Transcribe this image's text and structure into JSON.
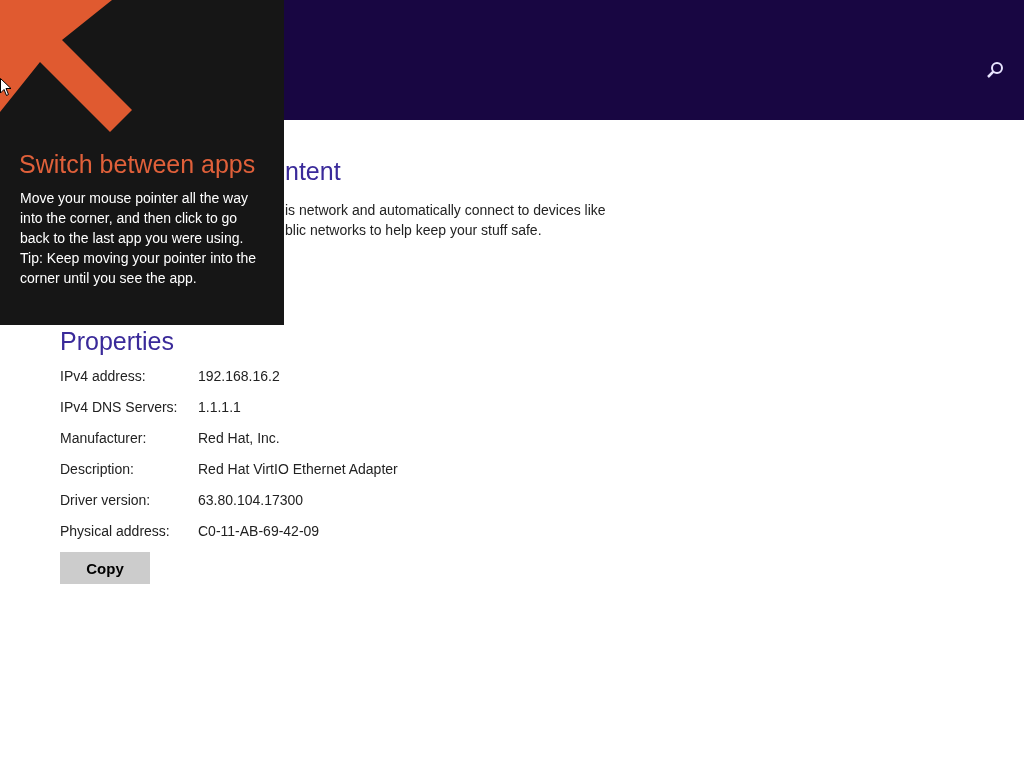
{
  "section": {
    "heading": "ntent",
    "text": "is network and automatically connect to devices like\nblic networks to help keep your stuff safe."
  },
  "properties": {
    "heading": "Properties",
    "rows": [
      {
        "label": "IPv4 address:",
        "value": "192.168.16.2"
      },
      {
        "label": "IPv4 DNS Servers:",
        "value": "1.1.1.1"
      },
      {
        "label": "Manufacturer:",
        "value": "Red Hat, Inc."
      },
      {
        "label": "Description:",
        "value": "Red Hat VirtIO Ethernet Adapter"
      },
      {
        "label": "Driver version:",
        "value": "63.80.104.17300"
      },
      {
        "label": "Physical address:",
        "value": "C0-11-AB-69-42-09"
      }
    ],
    "copy_button": "Copy"
  },
  "tip": {
    "title": "Switch between apps",
    "body": [
      "Move your mouse pointer all the way into the corner, and then click to go back to the last app you were using.",
      "Tip: Keep moving your pointer into the corner until you see the app."
    ]
  }
}
